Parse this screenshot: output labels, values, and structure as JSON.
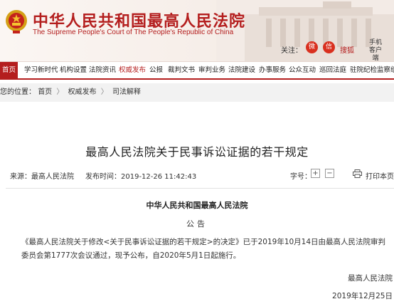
{
  "header": {
    "title_cn": "中华人民共和国最高人民法院",
    "title_en": "The Supreme People's Court of The People's Republic of China",
    "follow_label": "关注：",
    "zhihu_label": "搜狐",
    "mobile_label": "手机客户端",
    "brand_color": "#b41e1e"
  },
  "nav": {
    "items": [
      {
        "label": "首页"
      },
      {
        "label": "学习新时代"
      },
      {
        "label": "机构设置"
      },
      {
        "label": "法院资讯"
      },
      {
        "label": "权威发布"
      },
      {
        "label": "公报"
      },
      {
        "label": "裁判文书"
      },
      {
        "label": "审判业务"
      },
      {
        "label": "法院建设"
      },
      {
        "label": "办事服务"
      },
      {
        "label": "公众互动"
      },
      {
        "label": "巡回法庭"
      },
      {
        "label": "驻院纪检监察组"
      }
    ]
  },
  "breadcrumb": {
    "prefix": "您的位置：",
    "items": [
      "首页",
      "权威发布",
      "司法解释"
    ],
    "separator": "〉"
  },
  "article": {
    "title": "最高人民法院关于民事诉讼证据的若干规定",
    "source": "来源：最高人民法院",
    "publish_time": "发布时间：2019-12-26 11:42:43",
    "font_size_label": "字号：",
    "font_plus": "+",
    "font_minus": "−",
    "print_label": "打印本页",
    "court_name": "中华人民共和国最高人民法院",
    "notice": "公告",
    "body": "《最高人民法院关于修改<关于民事诉讼证据的若干规定>的决定》已于2019年10月14日由最高人民法院审判委员会第1777次会议通过，现予公布，自2020年5月1日起施行。",
    "signature": "最高人民法院",
    "date": "2019年12月25日"
  }
}
